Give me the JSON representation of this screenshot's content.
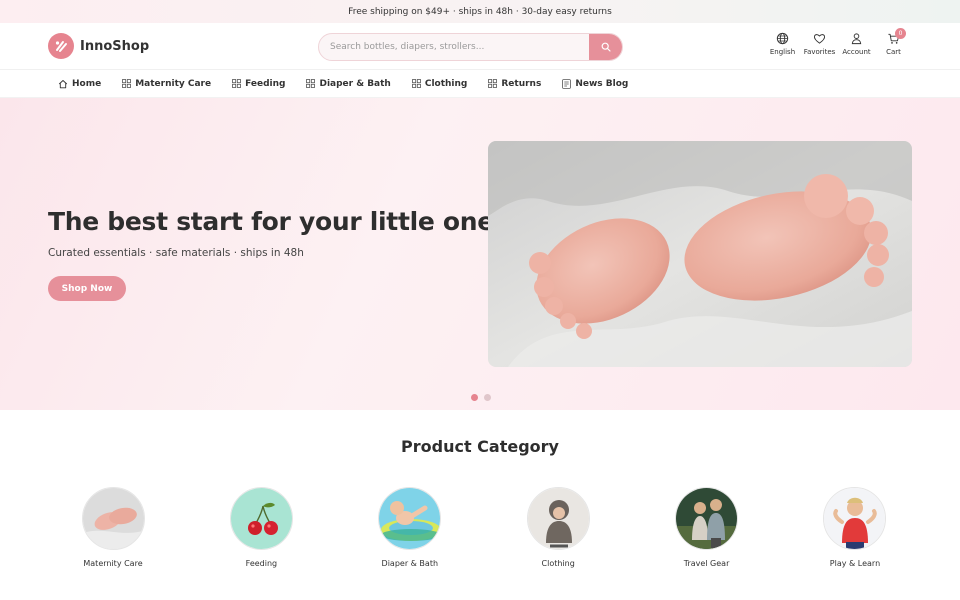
{
  "topbar": {
    "text": "Free shipping on $49+ · ships in 48h · 30-day easy returns"
  },
  "header": {
    "logo_text": "InnoShop",
    "search": {
      "placeholder": "Search bottles, diapers, strollers...",
      "value": ""
    },
    "actions": [
      {
        "label": "English",
        "icon": "globe-icon"
      },
      {
        "label": "Favorites",
        "icon": "heart-icon"
      },
      {
        "label": "Account",
        "icon": "user-icon"
      },
      {
        "label": "Cart",
        "icon": "cart-icon",
        "badge": "0"
      }
    ]
  },
  "nav": [
    {
      "label": "Home",
      "icon": "home-icon"
    },
    {
      "label": "Maternity Care",
      "icon": "grid-icon"
    },
    {
      "label": "Feeding",
      "icon": "grid-icon"
    },
    {
      "label": "Diaper & Bath",
      "icon": "grid-icon"
    },
    {
      "label": "Clothing",
      "icon": "grid-icon"
    },
    {
      "label": "Returns",
      "icon": "grid-icon"
    },
    {
      "label": "News Blog",
      "icon": "document-icon"
    }
  ],
  "hero": {
    "title": "The best start for your little one",
    "subtitle": "Curated essentials · safe materials · ships in 48h",
    "cta": "Shop Now",
    "slides": 2,
    "active_slide": 1
  },
  "categories": {
    "title": "Product Category",
    "items": [
      {
        "label": "Maternity Care"
      },
      {
        "label": "Feeding"
      },
      {
        "label": "Diaper & Bath"
      },
      {
        "label": "Clothing"
      },
      {
        "label": "Travel Gear"
      },
      {
        "label": "Play & Learn"
      }
    ]
  },
  "colors": {
    "accent": "#e6848f",
    "accent_light": "#e6909a",
    "hero_bg": "#fbe6eb",
    "text": "#2e2e2e"
  }
}
